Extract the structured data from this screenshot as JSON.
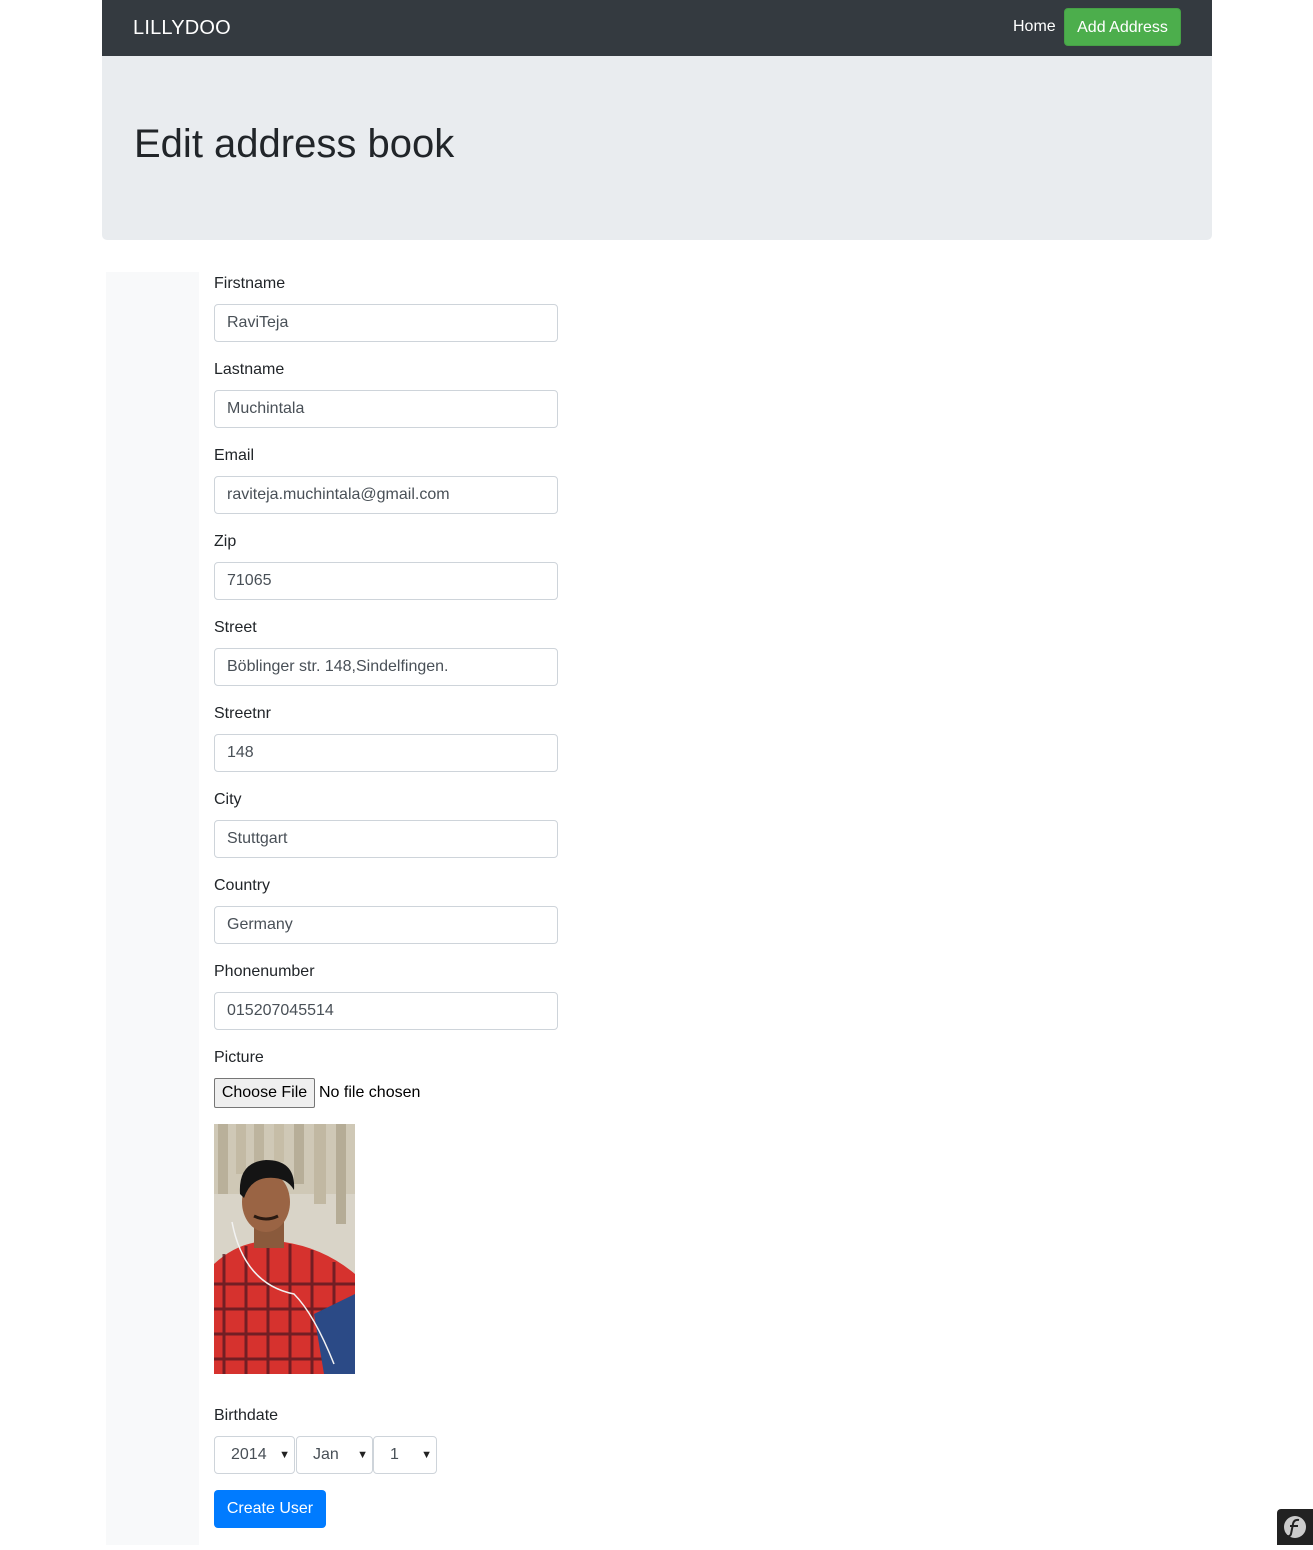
{
  "navbar": {
    "brand": "LILLYDOO",
    "home_label": "Home",
    "add_address_label": "Add Address"
  },
  "header": {
    "title": "Edit address book"
  },
  "form": {
    "firstname": {
      "label": "Firstname",
      "value": "RaviTeja"
    },
    "lastname": {
      "label": "Lastname",
      "value": "Muchintala"
    },
    "email": {
      "label": "Email",
      "value": "raviteja.muchintala@gmail.com"
    },
    "zip": {
      "label": "Zip",
      "value": "71065"
    },
    "street": {
      "label": "Street",
      "value": "Böblinger str. 148,Sindelfingen."
    },
    "streetnr": {
      "label": "Streetnr",
      "value": "148"
    },
    "city": {
      "label": "City",
      "value": "Stuttgart"
    },
    "country": {
      "label": "Country",
      "value": "Germany"
    },
    "phonenumber": {
      "label": "Phonenumber",
      "value": "015207045514"
    },
    "picture": {
      "label": "Picture",
      "button_label": "Choose File",
      "status": "No file chosen"
    },
    "birthdate": {
      "label": "Birthdate",
      "year": "2014",
      "month": "Jan",
      "day": "1"
    },
    "submit_label": "Create User"
  },
  "icons": {
    "select_arrow": "chevron-down-icon",
    "toolbar": "symfony-logo-icon"
  },
  "colors": {
    "navbar_bg": "#343a40",
    "add_button": "#4cae4c",
    "jumbotron_bg": "#e9ecef",
    "primary": "#007bff"
  }
}
